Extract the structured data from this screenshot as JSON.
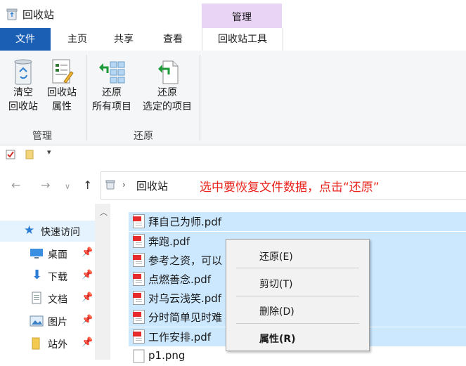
{
  "window": {
    "title": "回收站"
  },
  "tabs": {
    "context_group_label": "管理",
    "file": "文件",
    "home": "主页",
    "share": "共享",
    "view": "查看",
    "recycle_bin_tools": "回收站工具"
  },
  "ribbon": {
    "groups": [
      {
        "label": "管理",
        "buttons": [
          {
            "line1": "清空",
            "line2": "回收站",
            "icon": "recycle-bin-icon"
          },
          {
            "line1": "回收站",
            "line2": "属性",
            "icon": "properties-icon"
          }
        ]
      },
      {
        "label": "还原",
        "buttons": [
          {
            "line1": "还原",
            "line2": "所有项目",
            "icon": "restore-all-icon"
          },
          {
            "line1": "还原",
            "line2": "选定的项目",
            "icon": "restore-selected-icon"
          }
        ]
      }
    ]
  },
  "address": {
    "location": "回收站"
  },
  "annotation": "选中要恢复文件数据，点击“还原”",
  "nav": {
    "items": [
      {
        "label": "快速访问",
        "icon": "star-icon"
      },
      {
        "label": "桌面",
        "icon": "desktop-icon"
      },
      {
        "label": "下载",
        "icon": "download-icon"
      },
      {
        "label": "文档",
        "icon": "document-icon"
      },
      {
        "label": "图片",
        "icon": "picture-icon"
      },
      {
        "label": "站外",
        "icon": "folder-icon"
      }
    ]
  },
  "files": [
    {
      "name": "拜自己为师.pdf",
      "selected": true
    },
    {
      "name": "奔跑.pdf",
      "selected": true
    },
    {
      "name": "参考之资，可以",
      "selected": true
    },
    {
      "name": "点燃善念.pdf",
      "selected": true
    },
    {
      "name": "对乌云浅笑.pdf",
      "selected": true
    },
    {
      "name": "分时简单见时难",
      "selected": true
    },
    {
      "name": "工作安排.pdf",
      "selected": true
    },
    {
      "name": "p1.png",
      "selected": false
    }
  ],
  "context_menu": {
    "items": [
      {
        "label": "还原(E)"
      },
      {
        "label": "剪切(T)"
      },
      {
        "label": "删除(D)"
      },
      {
        "label": "属性(R)",
        "bold": true
      }
    ]
  },
  "colors": {
    "file_tab": "#1a5fb4",
    "context_tab_group": "#e9d4f6",
    "selection": "#cce8ff",
    "annotation": "#e8231b"
  }
}
